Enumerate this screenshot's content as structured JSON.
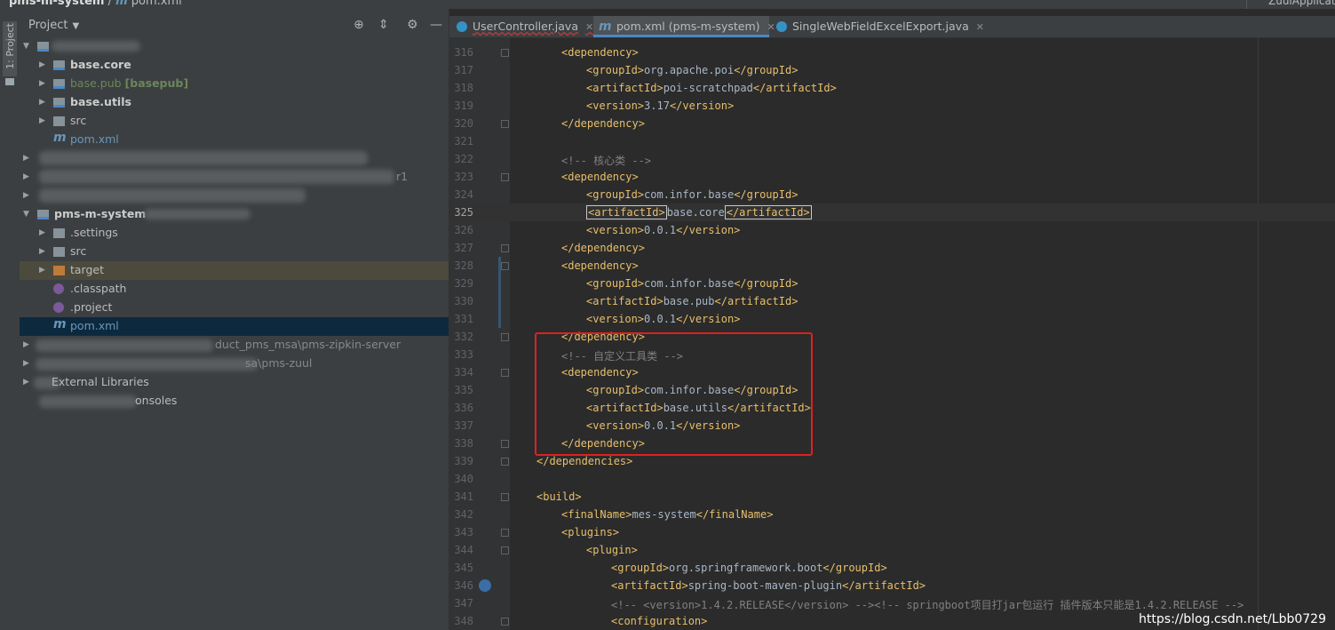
{
  "breadcrumb": {
    "project": "pms-m-system",
    "file": "pom.xml"
  },
  "run_config": "ZuulApplicati",
  "side_tab": "1: Project",
  "project_panel": {
    "title": "Project",
    "tree": [
      {
        "text": "base.core",
        "bold": true
      },
      {
        "text": "base.pub",
        "tag": "[basepub]",
        "color": "#6a8759"
      },
      {
        "text": "base.utils",
        "bold": true
      },
      {
        "text": "src"
      },
      {
        "text": "pom.xml",
        "color": "#6897bb"
      },
      {
        "text": "r1"
      },
      {
        "text": "pms-m-system"
      },
      {
        "text": ".settings"
      },
      {
        "text": "src"
      },
      {
        "text": "target"
      },
      {
        "text": ".classpath"
      },
      {
        "text": ".project"
      },
      {
        "text": "pom.xml",
        "color": "#6897bb"
      },
      {
        "text": "duct_pms_msa\\pms-zipkin-server"
      },
      {
        "text": "sa\\pms-zuul"
      },
      {
        "text": "External Libraries"
      },
      {
        "text": "onsoles"
      }
    ]
  },
  "tabs": [
    {
      "label": "UserController.java"
    },
    {
      "label": "pom.xml (pms-m-system)"
    },
    {
      "label": "SingleWebFieldExcelExport.java"
    }
  ],
  "code_lines": [
    {
      "no": "316",
      "code": "<dependency>"
    },
    {
      "no": "317",
      "code": "<groupId>org.apache.poi</groupId>"
    },
    {
      "no": "318",
      "code": "<artifactId>poi-scratchpad</artifactId>"
    },
    {
      "no": "319",
      "code": "<version>3.17</version>"
    },
    {
      "no": "320",
      "code": "</dependency>"
    },
    {
      "no": "321",
      "code": ""
    },
    {
      "no": "322",
      "code": "<!-- 核心类 -->"
    },
    {
      "no": "323",
      "code": "<dependency>"
    },
    {
      "no": "324",
      "code": "<groupId>com.infor.base</groupId>"
    },
    {
      "no": "325",
      "code": "<artifactId>base.core</artifactId>"
    },
    {
      "no": "326",
      "code": "<version>0.0.1</version>"
    },
    {
      "no": "327",
      "code": "</dependency>"
    },
    {
      "no": "328",
      "code": "<dependency>"
    },
    {
      "no": "329",
      "code": "<groupId>com.infor.base</groupId>"
    },
    {
      "no": "330",
      "code": "<artifactId>base.pub</artifactId>"
    },
    {
      "no": "331",
      "code": "<version>0.0.1</version>"
    },
    {
      "no": "332",
      "code": "</dependency>"
    },
    {
      "no": "333",
      "code": "<!-- 自定义工具类 -->"
    },
    {
      "no": "334",
      "code": "<dependency>"
    },
    {
      "no": "335",
      "code": "<groupId>com.infor.base</groupId>"
    },
    {
      "no": "336",
      "code": "<artifactId>base.utils</artifactId>"
    },
    {
      "no": "337",
      "code": "<version>0.0.1</version>"
    },
    {
      "no": "338",
      "code": "</dependency>"
    },
    {
      "no": "339",
      "code": "</dependencies>"
    },
    {
      "no": "340",
      "code": ""
    },
    {
      "no": "341",
      "code": "<build>"
    },
    {
      "no": "342",
      "code": "<finalName>mes-system</finalName>"
    },
    {
      "no": "343",
      "code": "<plugins>"
    },
    {
      "no": "344",
      "code": "<plugin>"
    },
    {
      "no": "345",
      "code": "<groupId>org.springframework.boot</groupId>"
    },
    {
      "no": "346",
      "code": "<artifactId>spring-boot-maven-plugin</artifactId>"
    },
    {
      "no": "347",
      "code": "<!-- <version>1.4.2.RELEASE</version> --><!-- springboot项目打jar包运行 插件版本只能是1.4.2.RELEASE -->"
    },
    {
      "no": "348",
      "code": "<configuration>"
    }
  ],
  "watermark": "https://blog.csdn.net/Lbb0729"
}
